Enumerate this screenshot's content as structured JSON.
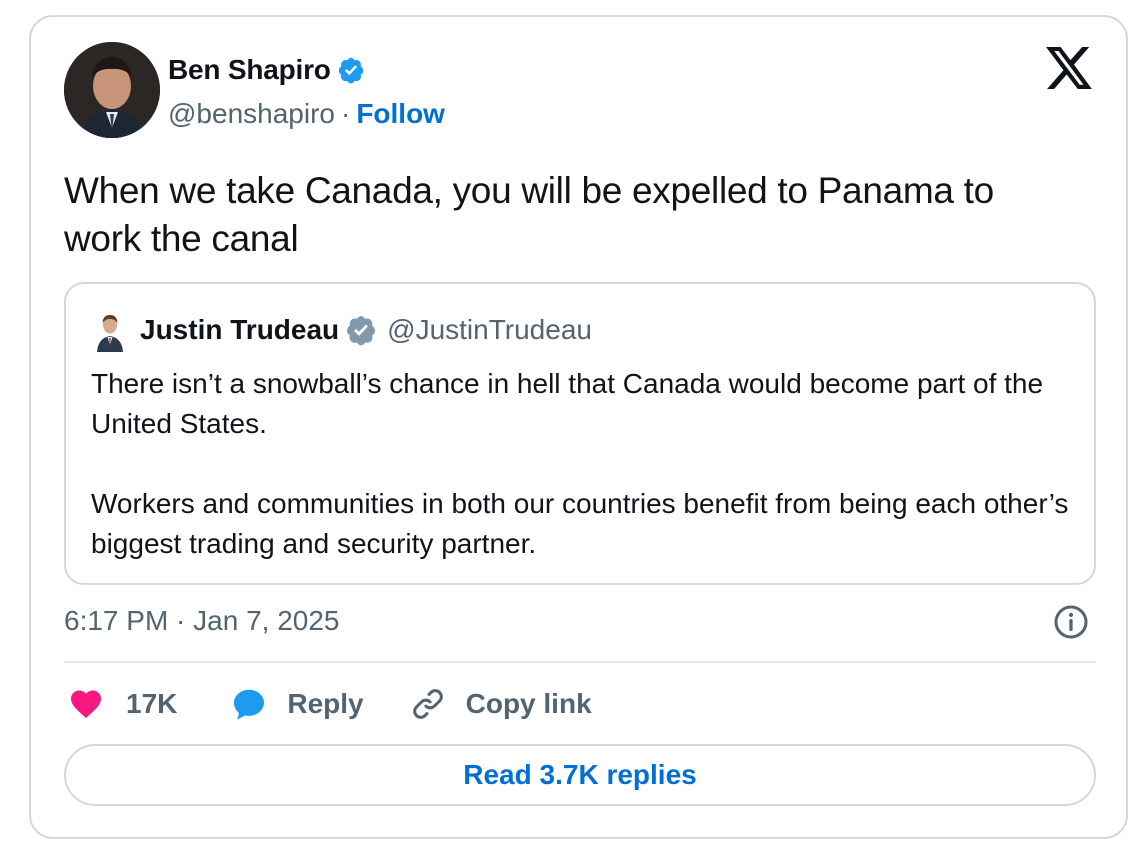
{
  "author": {
    "name": "Ben Shapiro",
    "handle": "@benshapiro",
    "separator": "·",
    "follow_label": "Follow"
  },
  "tweet": {
    "text": "When we take Canada, you will be expelled to Panama to work the canal",
    "timestamp": "6:17 PM · Jan 7, 2025"
  },
  "quoted_tweet": {
    "name": "Justin Trudeau",
    "handle": "@JustinTrudeau",
    "paragraphs": [
      "There isn’t a snowball’s chance in hell that Canada would become part of the United States.",
      "Workers and communities in both our countries benefit from being each other’s biggest trading and security partner."
    ]
  },
  "actions": {
    "like_count": "17K",
    "reply_label": "Reply",
    "copy_label": "Copy link"
  },
  "read_replies_label": "Read 3.7K replies",
  "icons": {
    "like": "heart-icon",
    "reply": "speech-bubble-icon",
    "copy": "link-icon",
    "info": "info-icon",
    "verified": "verified-badge-icon",
    "brand": "x-logo-icon"
  },
  "colors": {
    "accent": "#006fd6",
    "verified_blue": "#1d9bf0",
    "verified_gray": "#829aab",
    "like_pink": "#f91880",
    "muted_text": "#536471",
    "border": "#cfd9de"
  }
}
